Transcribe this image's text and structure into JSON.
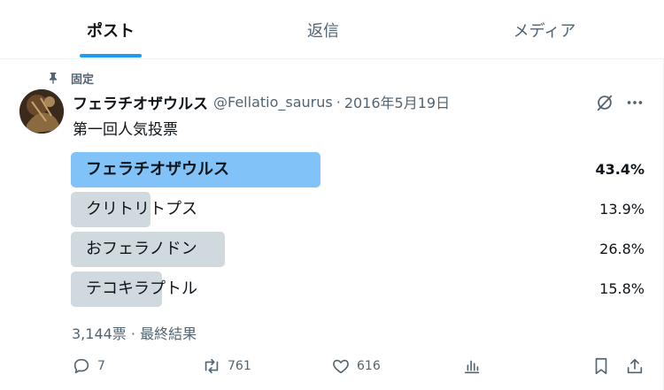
{
  "tabs": [
    {
      "label": "ポスト",
      "active": true
    },
    {
      "label": "返信",
      "active": false
    },
    {
      "label": "メディア",
      "active": false
    }
  ],
  "pinned_label": "固定",
  "tweet": {
    "display_name": "フェラチオザウルス",
    "handle": "@Fellatio_saurus",
    "separator": "·",
    "date": "2016年5月19日",
    "text": "第一回人気投票"
  },
  "poll": {
    "options": [
      {
        "label": "フェラチオザウルス",
        "percent": "43.4%",
        "value": 43.4,
        "winner": true
      },
      {
        "label": "クリトリトプス",
        "percent": "13.9%",
        "value": 13.9,
        "winner": false
      },
      {
        "label": "おフェラノドン",
        "percent": "26.8%",
        "value": 26.8,
        "winner": false
      },
      {
        "label": "テコキラプトル",
        "percent": "15.8%",
        "value": 15.8,
        "winner": false
      }
    ],
    "footer": "3,144票 · 最終結果"
  },
  "actions": {
    "reply_count": "7",
    "repost_count": "761",
    "like_count": "616"
  },
  "colors": {
    "accent": "#1d9bf0",
    "winner_bar": "#81c3f8",
    "bar": "#cfd9de",
    "secondary_text": "#536471"
  }
}
